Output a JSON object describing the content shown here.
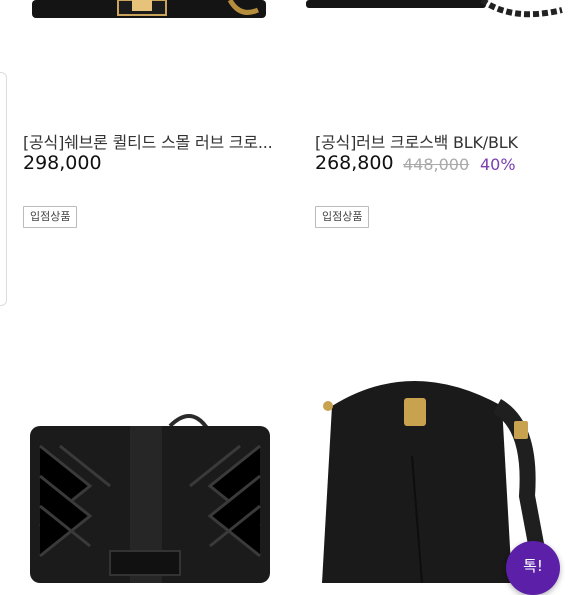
{
  "products": [
    {
      "title": "[공식]쉐브론 퀼티드 스몰 러브 크로...",
      "price": "298,000",
      "original_price": "",
      "discount": "",
      "badge": "입점상품"
    },
    {
      "title": "[공식]러브 크로스백 BLK/BLK",
      "price": "268,800",
      "original_price": "448,000",
      "discount": "40%",
      "badge": "입점상품"
    }
  ],
  "chat_button": {
    "label": "톡!"
  }
}
